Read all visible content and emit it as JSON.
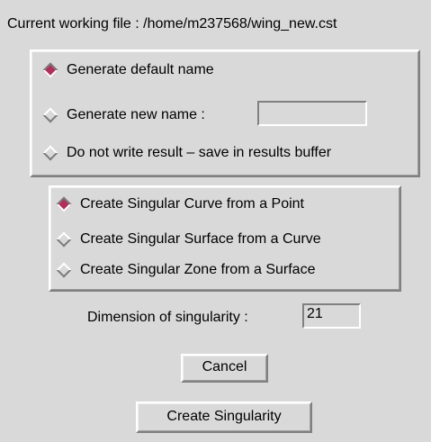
{
  "header": {
    "current_file_label": "Current working file : /home/m237568/wing_new.cst"
  },
  "name_options": {
    "items": [
      {
        "label": "Generate default name",
        "selected": true
      },
      {
        "label": "Generate new name :",
        "selected": false
      },
      {
        "label": "Do not write result – save in results buffer",
        "selected": false
      }
    ],
    "new_name_value": ""
  },
  "singular_options": {
    "items": [
      {
        "label": "Create Singular Curve from a Point",
        "selected": true
      },
      {
        "label": "Create Singular Surface from a Curve",
        "selected": false
      },
      {
        "label": "Create Singular Zone from a Surface",
        "selected": false
      }
    ]
  },
  "dimension": {
    "label": "Dimension of singularity :",
    "value": "21"
  },
  "buttons": {
    "cancel": "Cancel",
    "create": "Create Singularity"
  },
  "colors": {
    "background": "#d9d9d9",
    "radio_selected": "#b0305a"
  },
  "icons": {
    "radio_selected": "diamond-filled-icon",
    "radio_unselected": "diamond-empty-icon"
  }
}
